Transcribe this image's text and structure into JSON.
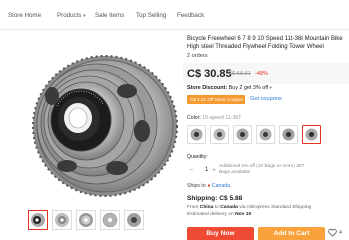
{
  "nav": {
    "items": [
      "Store Home",
      "Products",
      "Sale Items",
      "Top Selling",
      "Feedback"
    ]
  },
  "product": {
    "title": "Bicycle Freewheel 6 7 8 9 10 Speed 11t-36t Mountain Bike High steel Threaded Flywheel Folding Tower Wheel",
    "orders": "2 orders",
    "price": "C$ 30.85",
    "old_price": "C$ 58.31",
    "discount": "-48%",
    "store_discount_label": "Store Discount:",
    "store_discount_value": "Buy 2 get 3% off",
    "coupon": "C$ 4.21 Off Store Coupon",
    "get_coupons": "Get coupons",
    "color_label": "Color:",
    "color_value": "10-speed 11-36T",
    "quantity_label": "Quantity:",
    "quantity": "1",
    "quantity_note": "Additional 2% off (10 Bags or more) 307 Bags available",
    "ship_to_label": "Ships to",
    "ship_to_country": "Canada",
    "shipping": "Shipping: C$ 5.88",
    "ship_from_prefix": "From",
    "ship_from_country": "China",
    "ship_from_mid": "to",
    "ship_to_dest": "Canada",
    "ship_method": "via AliExpress Standard Shipping",
    "delivery_prefix": "Estimated delivery on",
    "delivery_date": "Nov 10",
    "buy_now": "Buy Now",
    "add_to_cart": "Add to Cart",
    "wishlist_count": "4"
  },
  "colors": {
    "accent": "#e43225",
    "buy": "#ee4a34",
    "cart": "#f9a13a",
    "coupon": "#f59a2f",
    "link": "#2a7bd5"
  }
}
